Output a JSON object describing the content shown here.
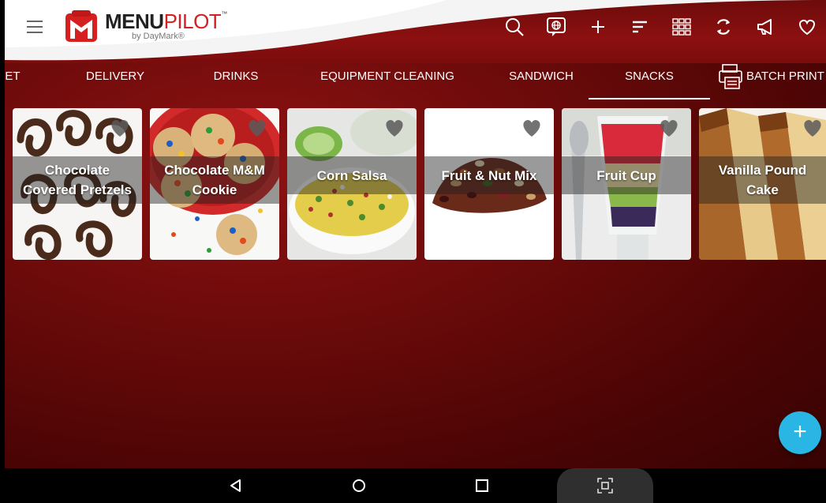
{
  "app": {
    "logo": {
      "menu": "MENU",
      "pilot": "PILOT",
      "tm": "™",
      "by": "by DayMark®"
    },
    "toolbar": [
      "search-icon",
      "translate-icon",
      "add-icon",
      "sort-icon",
      "grid-icon",
      "sync-icon",
      "announcement-icon",
      "favorite-icon"
    ]
  },
  "tabs": [
    {
      "label": "ET",
      "active": false
    },
    {
      "label": "DELIVERY",
      "active": false
    },
    {
      "label": "DRINKS",
      "active": false
    },
    {
      "label": "EQUIPMENT CLEANING",
      "active": false
    },
    {
      "label": "SANDWICH",
      "active": false
    },
    {
      "label": "SNACKS",
      "active": true
    },
    {
      "label": "BATCH PRINT",
      "active": false
    }
  ],
  "items": [
    {
      "name": "Chocolate Covered Pretzels",
      "line1": "Chocolate",
      "line2": "Covered Pretzels"
    },
    {
      "name": "Chocolate M&M Cookie",
      "line1": "Chocolate M&M",
      "line2": "Cookie"
    },
    {
      "name": "Corn Salsa",
      "line1": "Corn Salsa",
      "line2": ""
    },
    {
      "name": "Fruit & Nut Mix",
      "line1": "Fruit & Nut Mix",
      "line2": ""
    },
    {
      "name": "Fruit Cup",
      "line1": "Fruit Cup",
      "line2": ""
    },
    {
      "name": "Vanilla Pound Cake",
      "line1": "Vanilla Pound",
      "line2": "Cake"
    }
  ],
  "fab": {
    "label": "+"
  },
  "colors": {
    "accent": "#29b6e4",
    "header_red": "#8c1010",
    "brand_red": "#d42020"
  }
}
